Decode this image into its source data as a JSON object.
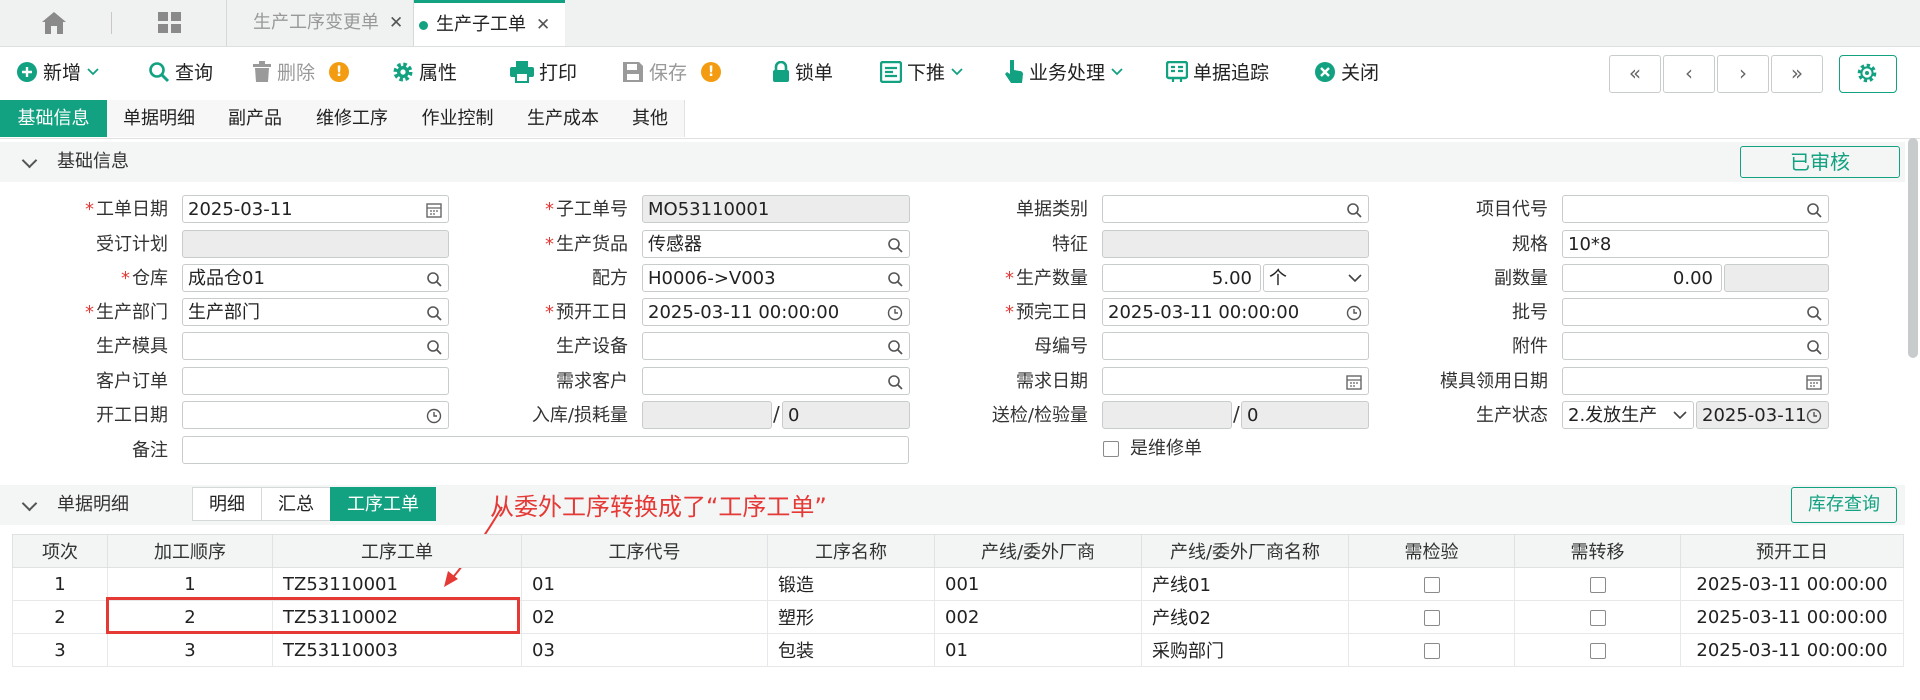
{
  "tabs": [
    {
      "label": "生产工序变更单",
      "active": false
    },
    {
      "label": "生产子工单",
      "active": true
    }
  ],
  "toolbar": {
    "new": "新增",
    "query": "查询",
    "delete": "删除",
    "properties": "属性",
    "print": "打印",
    "save": "保存",
    "lock": "锁单",
    "push_down": "下推",
    "business": "业务处理",
    "trace": "单据追踪",
    "close": "关闭"
  },
  "section_tabs": [
    "基础信息",
    "单据明细",
    "副产品",
    "维修工序",
    "作业控制",
    "生产成本",
    "其他"
  ],
  "basic": {
    "title": "基础信息",
    "status_badge": "已审核",
    "fields": {
      "work_date": {
        "label": "工单日期",
        "value": "2025-03-11"
      },
      "sub_order_no": {
        "label": "子工单号",
        "value": "MO53110001"
      },
      "doc_type": {
        "label": "单据类别",
        "value": ""
      },
      "project_code": {
        "label": "项目代号",
        "value": ""
      },
      "order_plan": {
        "label": "受订计划",
        "value": ""
      },
      "product": {
        "label": "生产货品",
        "value": "传感器"
      },
      "feature": {
        "label": "特征",
        "value": ""
      },
      "spec": {
        "label": "规格",
        "value": "10*8"
      },
      "warehouse": {
        "label": "仓库",
        "value": "成品仓01"
      },
      "recipe": {
        "label": "配方",
        "value": "H0006->V003"
      },
      "qty": {
        "label": "生产数量",
        "value": "5.00",
        "unit": "个"
      },
      "sub_qty": {
        "label": "副数量",
        "value": "0.00"
      },
      "dept": {
        "label": "生产部门",
        "value": "生产部门"
      },
      "plan_start": {
        "label": "预开工日",
        "value": "2025-03-11 00:00:00"
      },
      "plan_finish": {
        "label": "预完工日",
        "value": "2025-03-11 00:00:00"
      },
      "batch": {
        "label": "批号",
        "value": ""
      },
      "mold": {
        "label": "生产模具",
        "value": ""
      },
      "equipment": {
        "label": "生产设备",
        "value": ""
      },
      "parent_no": {
        "label": "母编号",
        "value": ""
      },
      "attachment": {
        "label": "附件",
        "value": ""
      },
      "customer_order": {
        "label": "客户订单",
        "value": ""
      },
      "demand_customer": {
        "label": "需求客户",
        "value": ""
      },
      "demand_date": {
        "label": "需求日期",
        "value": ""
      },
      "mold_date": {
        "label": "模具领用日期",
        "value": ""
      },
      "start_date": {
        "label": "开工日期",
        "value": ""
      },
      "instock_loss": {
        "label": "入库/损耗量",
        "value_a": "",
        "value_b": "0"
      },
      "inspect_qty": {
        "label": "送检/检验量",
        "value_a": "",
        "value_b": "0"
      },
      "prod_status": {
        "label": "生产状态",
        "value": "2.发放生产",
        "date": "2025-03-11"
      },
      "remark": {
        "label": "备注",
        "value": ""
      },
      "is_repair": {
        "label": "是维修单",
        "checked": false
      }
    }
  },
  "detail": {
    "title": "单据明细",
    "sub_tabs": [
      "明细",
      "汇总",
      "工序工单"
    ],
    "active_sub_tab": "工序工单",
    "stock_button": "库存查询",
    "annotation": "从委外工序转换成了“工序工单”",
    "columns": [
      "项次",
      "加工顺序",
      "工序工单",
      "工序代号",
      "工序名称",
      "产线/委外厂商",
      "产线/委外厂商名称",
      "需检验",
      "需转移",
      "预开工日"
    ],
    "rows": [
      {
        "item": "1",
        "seq": "1",
        "order": "TZ53110001",
        "code": "01",
        "name": "锻造",
        "line": "001",
        "line_name": "产线01",
        "inspect": false,
        "transfer": false,
        "start": "2025-03-11 00:00:00"
      },
      {
        "item": "2",
        "seq": "2",
        "order": "TZ53110002",
        "code": "02",
        "name": "塑形",
        "line": "002",
        "line_name": "产线02",
        "inspect": false,
        "transfer": false,
        "start": "2025-03-11 00:00:00"
      },
      {
        "item": "3",
        "seq": "3",
        "order": "TZ53110003",
        "code": "03",
        "name": "包装",
        "line": "01",
        "line_name": "采购部门",
        "inspect": false,
        "transfer": false,
        "start": "2025-03-11 00:00:00"
      }
    ]
  },
  "colors": {
    "accent": "#13a281",
    "warning": "#f39c12",
    "annotation": "#e53935"
  }
}
